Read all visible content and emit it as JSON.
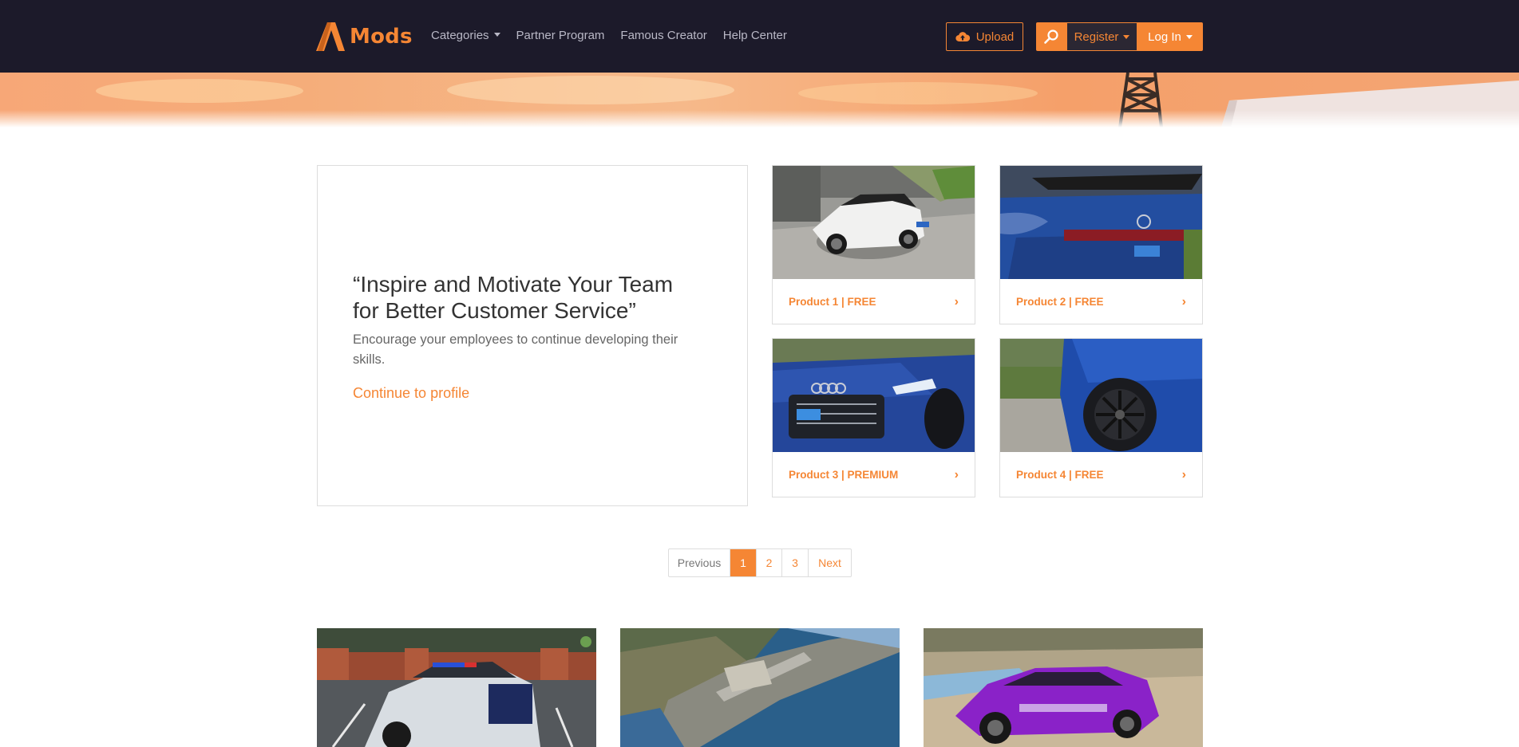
{
  "brand": {
    "name": "Mods",
    "accent": "#f58634",
    "nav_bg": "#1c1a2a"
  },
  "nav": {
    "items": [
      {
        "label": "Categories",
        "dropdown": true
      },
      {
        "label": "Partner Program"
      },
      {
        "label": "Famous Creator"
      },
      {
        "label": "Help Center"
      }
    ],
    "upload_label": "Upload",
    "register_label": "Register",
    "login_label": "Log In"
  },
  "quote": {
    "title": "“Inspire and Motivate Your Team for Better Customer Service”",
    "subtitle": "Encourage your employees to continue developing their skills.",
    "link": "Continue to profile"
  },
  "products": [
    {
      "label": "Product 1 | FREE",
      "icon": "white-audi-sedan-image"
    },
    {
      "label": "Product 2 | FREE",
      "icon": "blue-audi-rear-spoiler-image"
    },
    {
      "label": "Product 3 | PREMIUM",
      "icon": "blue-audi-suv-front-image"
    },
    {
      "label": "Product 4 | FREE",
      "icon": "blue-car-wheel-image"
    }
  ],
  "pagination": {
    "previous": "Previous",
    "pages": [
      "1",
      "2",
      "3"
    ],
    "current": "1",
    "next": "Next"
  },
  "bottom_cards": [
    {
      "icon": "police-car-image"
    },
    {
      "icon": "aerial-airport-image"
    },
    {
      "icon": "purple-suv-image"
    }
  ]
}
